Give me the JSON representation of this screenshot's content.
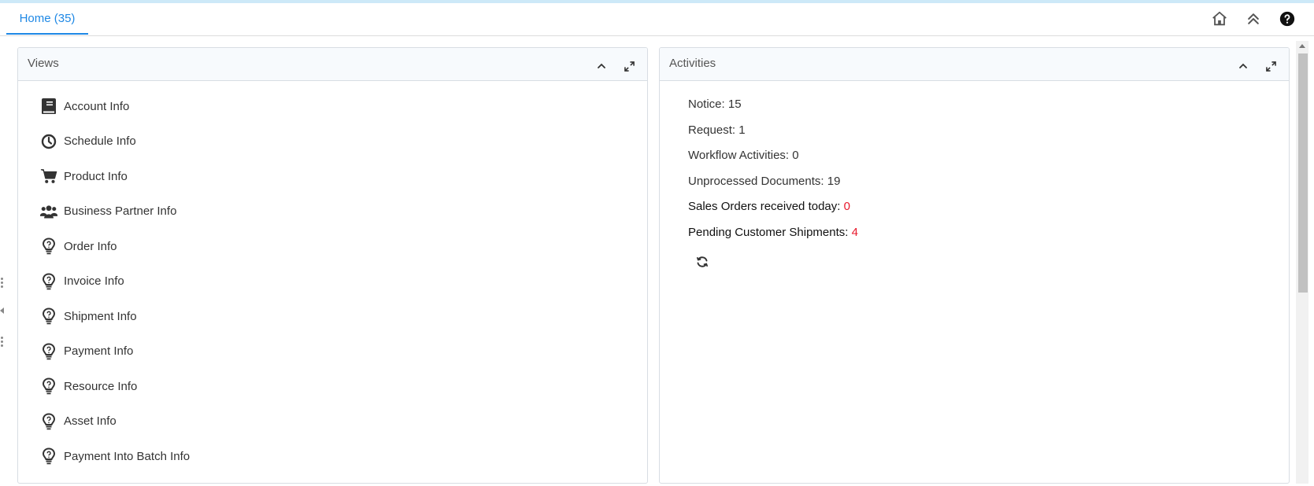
{
  "tabs": [
    {
      "label": "Home (35)"
    }
  ],
  "toolbar": {
    "icons": [
      "home-icon",
      "chevrons-up-icon",
      "help-icon"
    ]
  },
  "views_panel": {
    "title": "Views",
    "items": [
      {
        "label": "Account Info",
        "icon": "book-icon"
      },
      {
        "label": "Schedule Info",
        "icon": "clock-icon"
      },
      {
        "label": "Product Info",
        "icon": "cart-icon"
      },
      {
        "label": "Business Partner Info",
        "icon": "users-icon"
      },
      {
        "label": "Order Info",
        "icon": "lightbulb-icon"
      },
      {
        "label": "Invoice Info",
        "icon": "lightbulb-icon"
      },
      {
        "label": "Shipment Info",
        "icon": "lightbulb-icon"
      },
      {
        "label": "Payment Info",
        "icon": "lightbulb-icon"
      },
      {
        "label": "Resource Info",
        "icon": "lightbulb-icon"
      },
      {
        "label": "Asset Info",
        "icon": "lightbulb-icon"
      },
      {
        "label": "Payment Into Batch Info",
        "icon": "lightbulb-icon"
      }
    ]
  },
  "activities_panel": {
    "title": "Activities",
    "rows": [
      {
        "label": "Notice: ",
        "value": "15"
      },
      {
        "label": "Request: ",
        "value": "1"
      },
      {
        "label": "Workflow Activities: ",
        "value": "0"
      },
      {
        "label": "Unprocessed Documents: ",
        "value": "19"
      },
      {
        "label": "Sales Orders received today: ",
        "value": "0",
        "highlight": true
      },
      {
        "label": "Pending Customer Shipments: ",
        "value": "4",
        "highlight": true
      }
    ]
  },
  "colors": {
    "accent": "#1e88e5",
    "alert": "#e8192c"
  }
}
